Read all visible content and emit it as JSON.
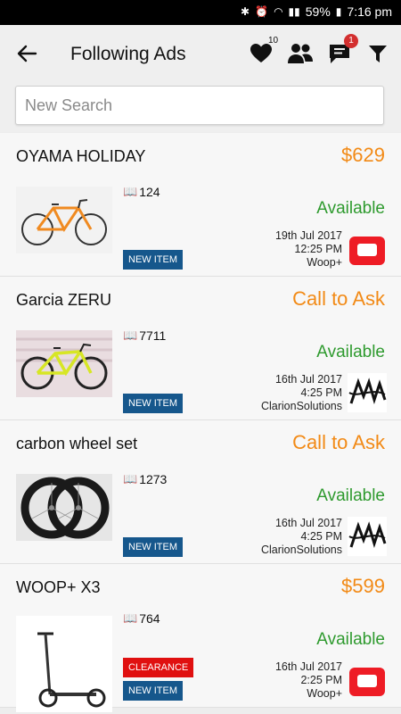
{
  "status_bar": {
    "battery": "59%",
    "time": "7:16 pm"
  },
  "header": {
    "title": "Following Ads",
    "favorites_count": "10",
    "messages_count": "1"
  },
  "search": {
    "placeholder": "New Search"
  },
  "ads": [
    {
      "name": "OYAMA HOLIDAY",
      "price": "$629",
      "views": "124",
      "status": "Available",
      "date": "19th Jul 2017",
      "time": "12:25 PM",
      "seller": "Woop+",
      "tags": [
        "NEW ITEM"
      ]
    },
    {
      "name": "Garcia ZERU",
      "price": "Call to Ask",
      "views": "7711",
      "status": "Available",
      "date": "16th Jul 2017",
      "time": "4:25 PM",
      "seller": "ClarionSolutions",
      "tags": [
        "NEW ITEM"
      ]
    },
    {
      "name": "carbon wheel set",
      "price": "Call to Ask",
      "views": "1273",
      "status": "Available",
      "date": "16th Jul 2017",
      "time": "4:25 PM",
      "seller": "ClarionSolutions",
      "tags": [
        "NEW ITEM"
      ]
    },
    {
      "name": "WOOP+ X3",
      "price": "$599",
      "views": "764",
      "status": "Available",
      "date": "16th Jul 2017",
      "time": "2:25 PM",
      "seller": "Woop+",
      "tags": [
        "CLEARANCE",
        "NEW ITEM"
      ]
    }
  ],
  "colors": {
    "price": "#f28a16",
    "available": "#2e9a2e",
    "new_tag": "#16578c",
    "clearance_tag": "#e01010"
  }
}
